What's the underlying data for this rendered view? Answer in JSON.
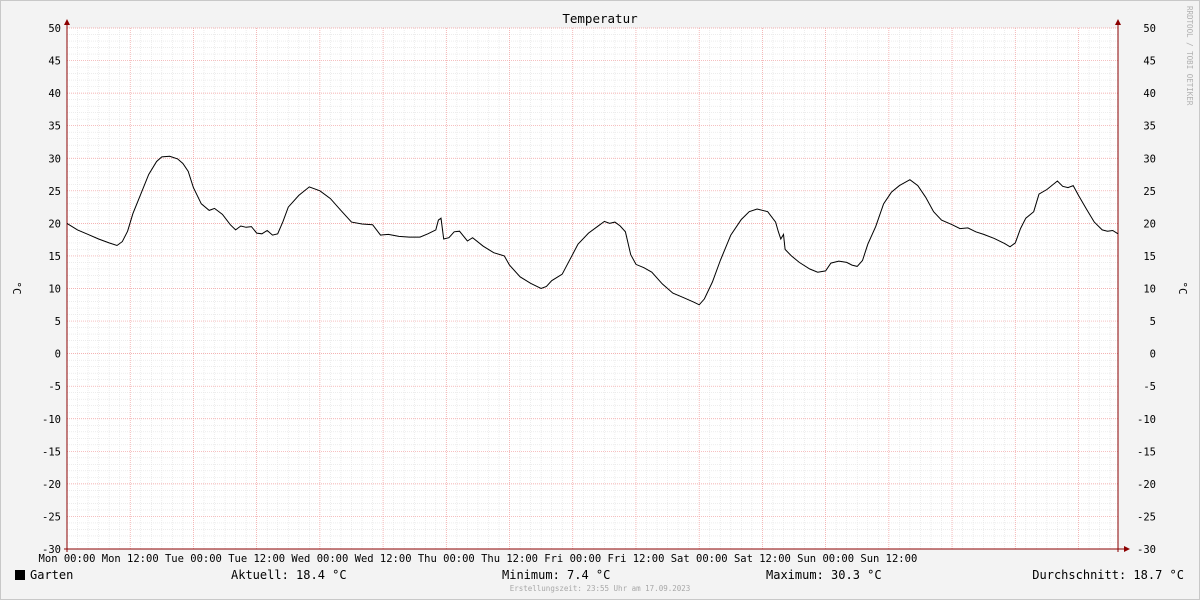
{
  "chart_data": {
    "type": "line",
    "title": "Temperatur",
    "ylabel": "°C",
    "ylim": [
      -30,
      50
    ],
    "yticks": [
      50,
      45,
      40,
      35,
      30,
      25,
      20,
      15,
      10,
      5,
      0,
      -5,
      -10,
      -15,
      -20,
      -25,
      -30
    ],
    "xlim": [
      0,
      168
    ],
    "xticks": [
      {
        "x": 0,
        "label": "Mon 00:00"
      },
      {
        "x": 12,
        "label": "Mon 12:00"
      },
      {
        "x": 24,
        "label": "Tue 00:00"
      },
      {
        "x": 36,
        "label": "Tue 12:00"
      },
      {
        "x": 48,
        "label": "Wed 00:00"
      },
      {
        "x": 60,
        "label": "Wed 12:00"
      },
      {
        "x": 72,
        "label": "Thu 00:00"
      },
      {
        "x": 84,
        "label": "Thu 12:00"
      },
      {
        "x": 96,
        "label": "Fri 00:00"
      },
      {
        "x": 108,
        "label": "Fri 12:00"
      },
      {
        "x": 120,
        "label": "Sat 00:00"
      },
      {
        "x": 132,
        "label": "Sat 12:00"
      },
      {
        "x": 144,
        "label": "Sun 00:00"
      },
      {
        "x": 156,
        "label": "Sun 12:00"
      }
    ],
    "grid": true,
    "series": [
      {
        "name": "Garten",
        "color": "#000000",
        "points": [
          [
            0,
            20.0
          ],
          [
            2,
            19.0
          ],
          [
            4,
            18.3
          ],
          [
            6,
            17.6
          ],
          [
            8,
            17.0
          ],
          [
            9.5,
            16.6
          ],
          [
            10.5,
            17.2
          ],
          [
            11.5,
            18.8
          ],
          [
            12.5,
            21.5
          ],
          [
            14,
            24.5
          ],
          [
            15.5,
            27.5
          ],
          [
            17,
            29.5
          ],
          [
            18,
            30.2
          ],
          [
            19.5,
            30.3
          ],
          [
            21,
            29.9
          ],
          [
            22,
            29.2
          ],
          [
            23,
            28.0
          ],
          [
            24,
            25.5
          ],
          [
            25.5,
            23.0
          ],
          [
            27,
            22.0
          ],
          [
            28,
            22.3
          ],
          [
            29.5,
            21.4
          ],
          [
            31,
            19.8
          ],
          [
            32,
            19.0
          ],
          [
            33,
            19.6
          ],
          [
            34,
            19.4
          ],
          [
            35,
            19.5
          ],
          [
            36,
            18.5
          ],
          [
            37,
            18.4
          ],
          [
            38,
            18.9
          ],
          [
            39,
            18.2
          ],
          [
            40,
            18.4
          ],
          [
            41,
            20.3
          ],
          [
            42,
            22.5
          ],
          [
            44,
            24.3
          ],
          [
            46,
            25.6
          ],
          [
            48,
            25.0
          ],
          [
            50,
            23.8
          ],
          [
            52,
            22.0
          ],
          [
            54,
            20.2
          ],
          [
            56,
            19.9
          ],
          [
            58,
            19.8
          ],
          [
            59.5,
            18.2
          ],
          [
            61,
            18.3
          ],
          [
            63,
            18.0
          ],
          [
            65,
            17.9
          ],
          [
            67,
            17.9
          ],
          [
            68.5,
            18.4
          ],
          [
            70,
            19.0
          ],
          [
            70.5,
            20.5
          ],
          [
            71,
            20.8
          ],
          [
            71.5,
            17.6
          ],
          [
            72.5,
            17.8
          ],
          [
            73.5,
            18.7
          ],
          [
            74.5,
            18.8
          ],
          [
            76,
            17.3
          ],
          [
            77,
            17.8
          ],
          [
            79,
            16.5
          ],
          [
            81,
            15.5
          ],
          [
            83,
            15.0
          ],
          [
            84,
            13.6
          ],
          [
            86,
            11.8
          ],
          [
            88,
            10.8
          ],
          [
            90,
            10.0
          ],
          [
            91,
            10.3
          ],
          [
            92,
            11.2
          ],
          [
            94,
            12.2
          ],
          [
            95.5,
            14.5
          ],
          [
            97,
            16.8
          ],
          [
            99,
            18.5
          ],
          [
            101,
            19.7
          ],
          [
            102,
            20.3
          ],
          [
            103,
            20.0
          ],
          [
            104,
            20.2
          ],
          [
            105,
            19.6
          ],
          [
            106,
            18.7
          ],
          [
            107,
            15.2
          ],
          [
            108,
            13.7
          ],
          [
            109.5,
            13.2
          ],
          [
            111,
            12.5
          ],
          [
            113,
            10.7
          ],
          [
            115,
            9.3
          ],
          [
            117,
            8.6
          ],
          [
            119,
            7.9
          ],
          [
            120,
            7.5
          ],
          [
            121,
            8.4
          ],
          [
            122.5,
            11.0
          ],
          [
            124,
            14.3
          ],
          [
            126,
            18.2
          ],
          [
            128,
            20.6
          ],
          [
            129.5,
            21.8
          ],
          [
            131,
            22.2
          ],
          [
            133,
            21.8
          ],
          [
            134.5,
            20.2
          ],
          [
            135,
            18.8
          ],
          [
            135.5,
            17.6
          ],
          [
            136,
            18.3
          ],
          [
            136.3,
            16.0
          ],
          [
            137.5,
            15.0
          ],
          [
            139,
            14.0
          ],
          [
            141,
            13.0
          ],
          [
            142.5,
            12.5
          ],
          [
            144,
            12.7
          ],
          [
            145,
            13.9
          ],
          [
            146.5,
            14.2
          ],
          [
            148,
            14.0
          ],
          [
            149,
            13.6
          ],
          [
            150,
            13.4
          ],
          [
            151,
            14.3
          ],
          [
            152,
            16.8
          ],
          [
            153.5,
            19.5
          ],
          [
            155,
            23.0
          ],
          [
            156.5,
            24.8
          ],
          [
            158,
            25.8
          ],
          [
            160,
            26.7
          ],
          [
            161.5,
            25.8
          ],
          [
            163,
            24.0
          ],
          [
            164.5,
            21.8
          ],
          [
            166,
            20.5
          ],
          [
            168,
            19.8
          ],
          [
            169.5,
            19.2
          ],
          [
            171,
            19.3
          ],
          [
            172.5,
            18.7
          ],
          [
            174,
            18.3
          ],
          [
            176,
            17.7
          ],
          [
            178,
            16.9
          ],
          [
            179,
            16.4
          ],
          [
            180,
            17.0
          ],
          [
            181,
            19.2
          ],
          [
            182,
            20.8
          ],
          [
            183.5,
            21.8
          ],
          [
            184.5,
            24.5
          ],
          [
            186,
            25.2
          ],
          [
            188,
            26.5
          ],
          [
            189,
            25.7
          ],
          [
            190,
            25.5
          ],
          [
            191,
            25.8
          ],
          [
            192,
            24.3
          ],
          [
            193.5,
            22.2
          ],
          [
            195,
            20.2
          ],
          [
            196.5,
            19.0
          ],
          [
            197.5,
            18.8
          ],
          [
            198.5,
            18.9
          ],
          [
            199.5,
            18.4
          ]
        ]
      }
    ],
    "legend": {
      "series_name": "Garten",
      "current": "Aktuell: 18.4 °C",
      "minimum": "Minimum: 7.4 °C",
      "maximum": "Maximum: 30.3 °C",
      "average": "Durchschnitt: 18.7 °C"
    },
    "watermark": "RRDTOOL / TOBI OETIKER",
    "footer": "Erstellungszeit: 23:55 Uhr am 17.09.2023"
  }
}
